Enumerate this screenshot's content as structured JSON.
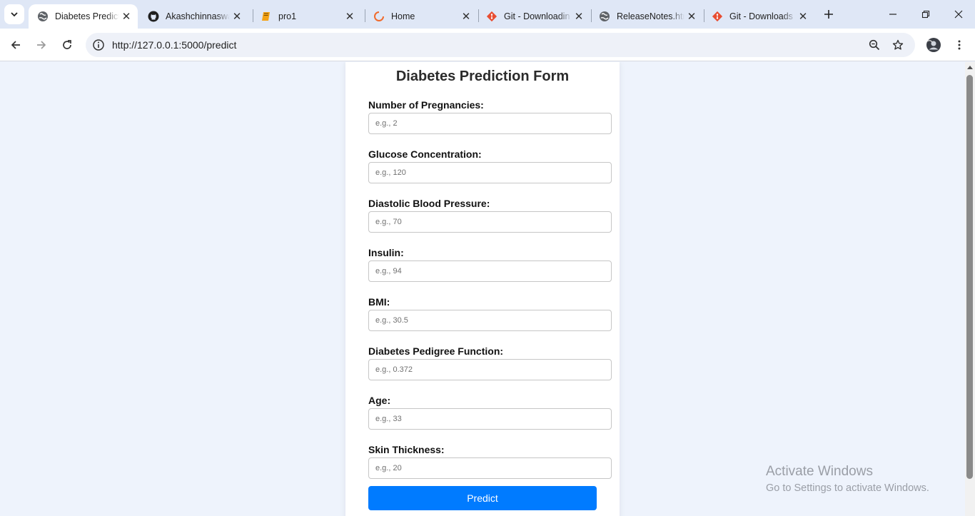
{
  "browser": {
    "tabs": [
      {
        "title": "Diabetes Predict",
        "active": true,
        "icon": "globe-icon"
      },
      {
        "title": "Akashchinnaswa",
        "active": false,
        "icon": "github-icon"
      },
      {
        "title": "pro1",
        "active": false,
        "icon": "book-icon"
      },
      {
        "title": "Home",
        "active": false,
        "icon": "loading-icon"
      },
      {
        "title": "Git - Downloadin",
        "active": false,
        "icon": "git-icon"
      },
      {
        "title": "ReleaseNotes.htm",
        "active": false,
        "icon": "globe-icon"
      },
      {
        "title": "Git - Downloads",
        "active": false,
        "icon": "git-icon"
      }
    ],
    "url": "http://127.0.0.1:5000/predict"
  },
  "form": {
    "title": "Diabetes Prediction Form",
    "fields": [
      {
        "label": "Number of Pregnancies:",
        "placeholder": "e.g., 2",
        "value": ""
      },
      {
        "label": "Glucose Concentration:",
        "placeholder": "e.g., 120",
        "value": ""
      },
      {
        "label": "Diastolic Blood Pressure:",
        "placeholder": "e.g., 70",
        "value": ""
      },
      {
        "label": "Insulin:",
        "placeholder": "e.g., 94",
        "value": ""
      },
      {
        "label": "BMI:",
        "placeholder": "e.g., 30.5",
        "value": ""
      },
      {
        "label": "Diabetes Pedigree Function:",
        "placeholder": "e.g., 0.372",
        "value": ""
      },
      {
        "label": "Age:",
        "placeholder": "e.g., 33",
        "value": ""
      },
      {
        "label": "Skin Thickness:",
        "placeholder": "e.g., 20",
        "value": ""
      }
    ],
    "submit_label": "Predict"
  },
  "watermark": {
    "line1": "Activate Windows",
    "line2": "Go to Settings to activate Windows."
  },
  "colors": {
    "accent": "#007bff",
    "page_background": "#eef3fc",
    "tabstrip_background": "#dfe7f6"
  }
}
